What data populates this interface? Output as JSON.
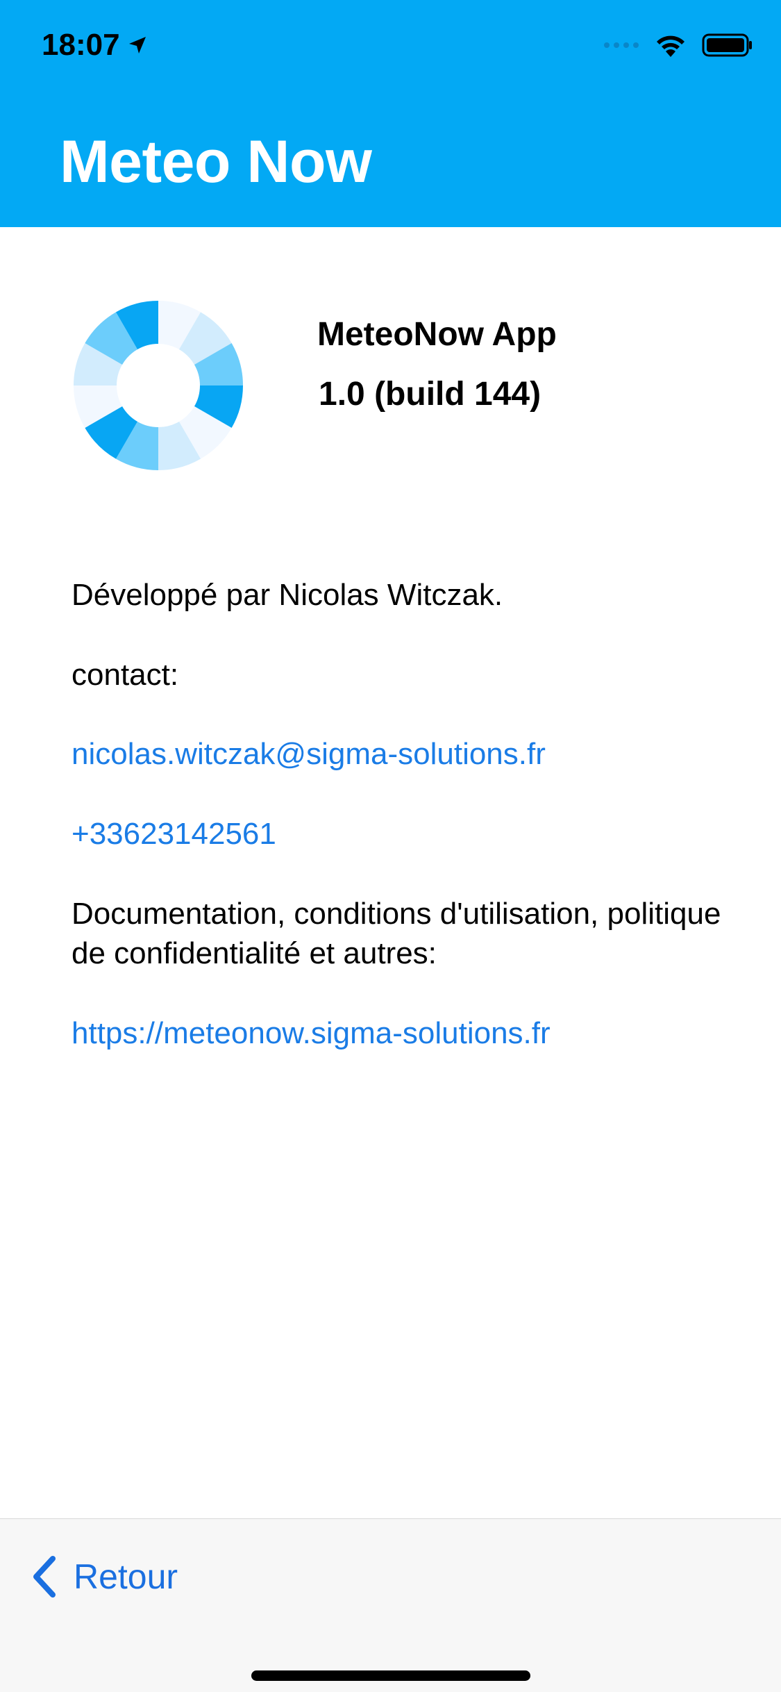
{
  "status_bar": {
    "time": "18:07",
    "location_icon": "location-arrow-icon",
    "wifi_icon": "wifi-icon",
    "battery_icon": "battery-icon"
  },
  "header": {
    "title": "Meteo Now",
    "background_color": "#03a9f4"
  },
  "about": {
    "app_name": "MeteoNow App",
    "version": "1.0 (build 144)",
    "developed_by": "Développé par Nicolas Witczak.",
    "contact_label": "contact:",
    "email": "nicolas.witczak@sigma-solutions.fr",
    "phone": "+33623142561",
    "docs_text": "Documentation, conditions d'utilisation, politique de confidentialité et autres:",
    "website": "https://meteonow.sigma-solutions.fr",
    "link_color": "#1a7ce6"
  },
  "toolbar": {
    "back_label": "Retour",
    "back_icon": "chevron-left-icon"
  }
}
